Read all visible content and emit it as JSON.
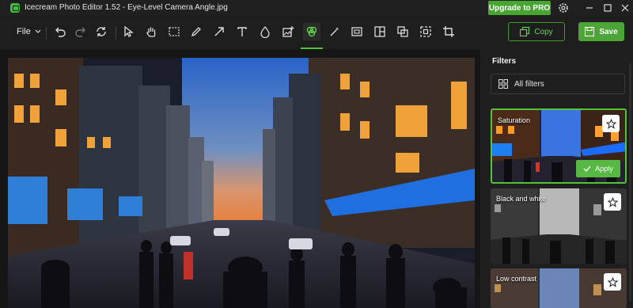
{
  "titlebar": {
    "title": "Icecream Photo Editor 1.52 - Eye-Level Camera Angle.jpg",
    "upgrade_label": "Upgrade to PRO",
    "settings_icon": "gear-icon"
  },
  "toolbar": {
    "file_label": "File",
    "tools": [
      "undo",
      "redo",
      "reset",
      "select",
      "pan",
      "crop-select",
      "brush",
      "arrow",
      "text",
      "blur",
      "image-insert",
      "filters",
      "magic",
      "resize",
      "collage",
      "transform",
      "frame",
      "crop"
    ],
    "active_tool": "filters",
    "copy_label": "Copy",
    "save_label": "Save"
  },
  "panel": {
    "title": "Filters",
    "dropdown_label": "All filters",
    "filters": [
      {
        "name": "Saturation",
        "selected": true,
        "apply_label": "Apply"
      },
      {
        "name": "Black and white",
        "selected": false
      },
      {
        "name": "Low contrast",
        "selected": false
      }
    ]
  },
  "colors": {
    "accent": "#4ca536",
    "background": "#1b1b1b",
    "panel": "#1f1f1f"
  }
}
